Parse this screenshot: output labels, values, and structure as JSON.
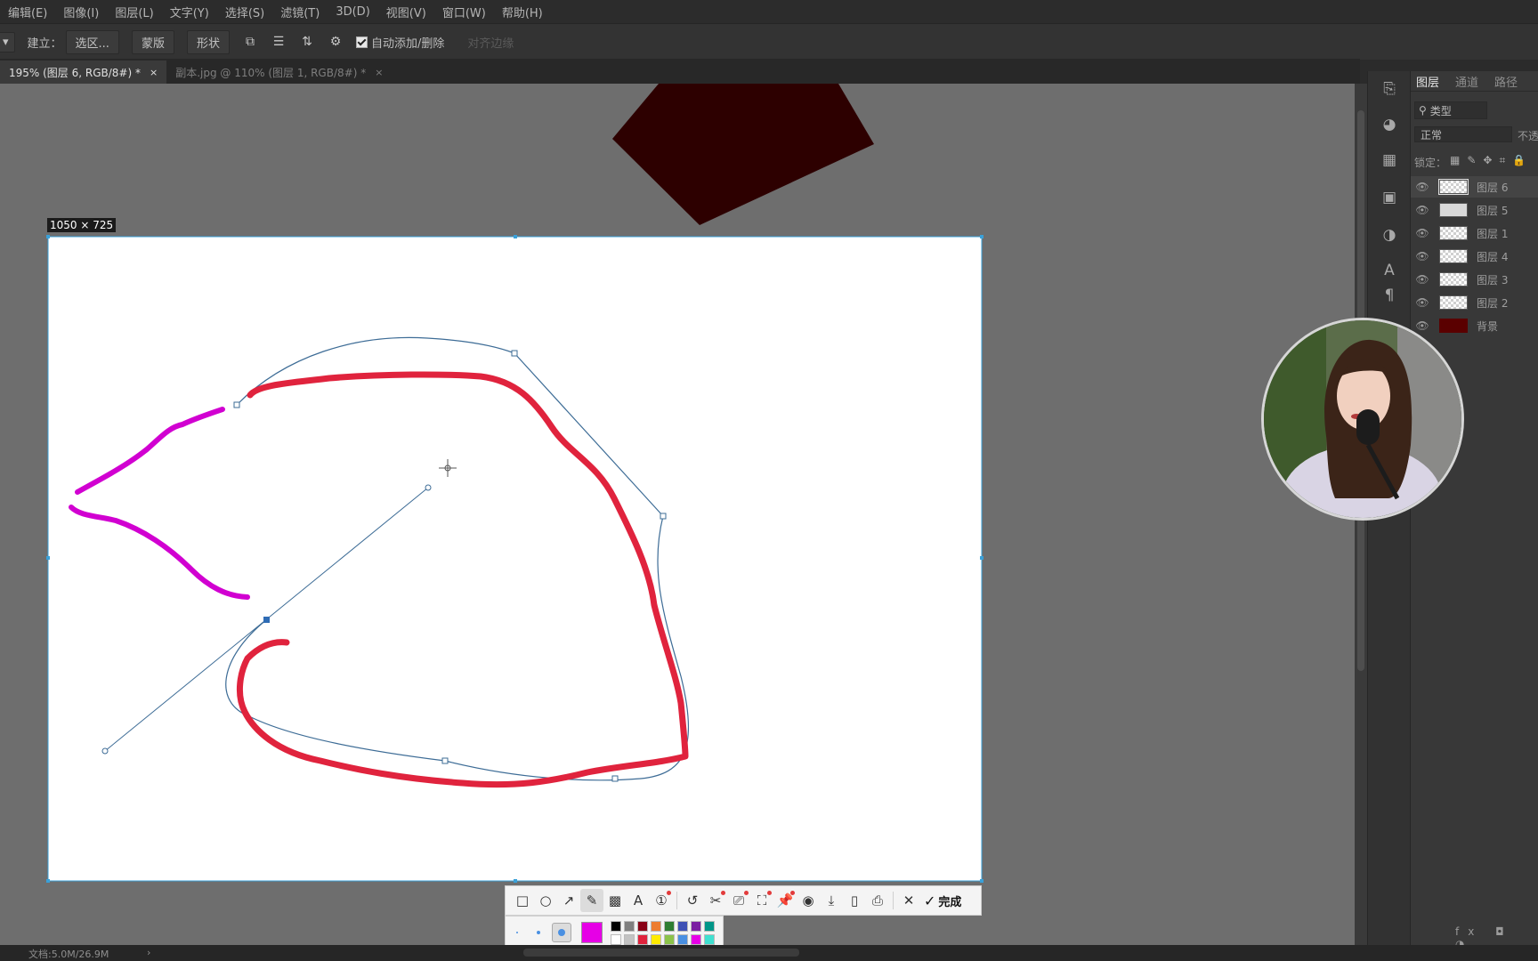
{
  "menu": [
    "编辑(E)",
    "图像(I)",
    "图层(L)",
    "文字(Y)",
    "选择(S)",
    "滤镜(T)",
    "3D(D)",
    "视图(V)",
    "窗口(W)",
    "帮助(H)"
  ],
  "options": {
    "build_label": "建立：",
    "selection_button": "选区...",
    "mask_button": "蒙版",
    "shape_button": "形状",
    "auto_add_delete": "自动添加/删除",
    "align_edges": "对齐边缘"
  },
  "tabs": [
    {
      "label": "195% (图层 6, RGB/8#) *",
      "active": true
    },
    {
      "label": "副本.jpg @ 110% (图层 1, RGB/8#) *",
      "active": false
    }
  ],
  "selection_size": "1050 × 725",
  "layers_panel": {
    "tabs": [
      "图层",
      "通道",
      "路径"
    ],
    "filter_label": "类型",
    "blend_mode": "正常",
    "opacity_label": "不透",
    "lock_label": "锁定：",
    "layers": [
      "图层 6",
      "图层 5",
      "图层 1",
      "图层 4",
      "图层 3",
      "图层 2",
      "背景"
    ]
  },
  "status": {
    "doc_size": "文档:5.0M/26.9M"
  },
  "snap_toolbar": {
    "tools": [
      "rectangle-icon",
      "ellipse-icon",
      "arrow-icon",
      "pencil-icon",
      "mosaic-icon",
      "text-icon",
      "number-icon",
      "undo-icon",
      "crop-icon",
      "translate-icon",
      "scan-icon",
      "pin-icon",
      "record-icon",
      "download-icon",
      "save-icon",
      "bookmark-icon",
      "close-icon"
    ],
    "done_label": "完成",
    "current_color": "#e600e6",
    "palette": [
      "#000000",
      "#7f7f7f",
      "#880015",
      "#ed7d31",
      "#2e7d32",
      "#3f51b5",
      "#7b1fa2",
      "#009688",
      "#ffffff",
      "#c3c3c3",
      "#e0233d",
      "#ffeb00",
      "#8bc34a",
      "#4a90e2",
      "#e600e6",
      "#40e0d0"
    ]
  },
  "colors": {
    "red_stroke": "#e0233d",
    "magenta_stroke": "#d100d1",
    "path_line": "#3d6c96",
    "dark_shape": "#2d0000"
  }
}
